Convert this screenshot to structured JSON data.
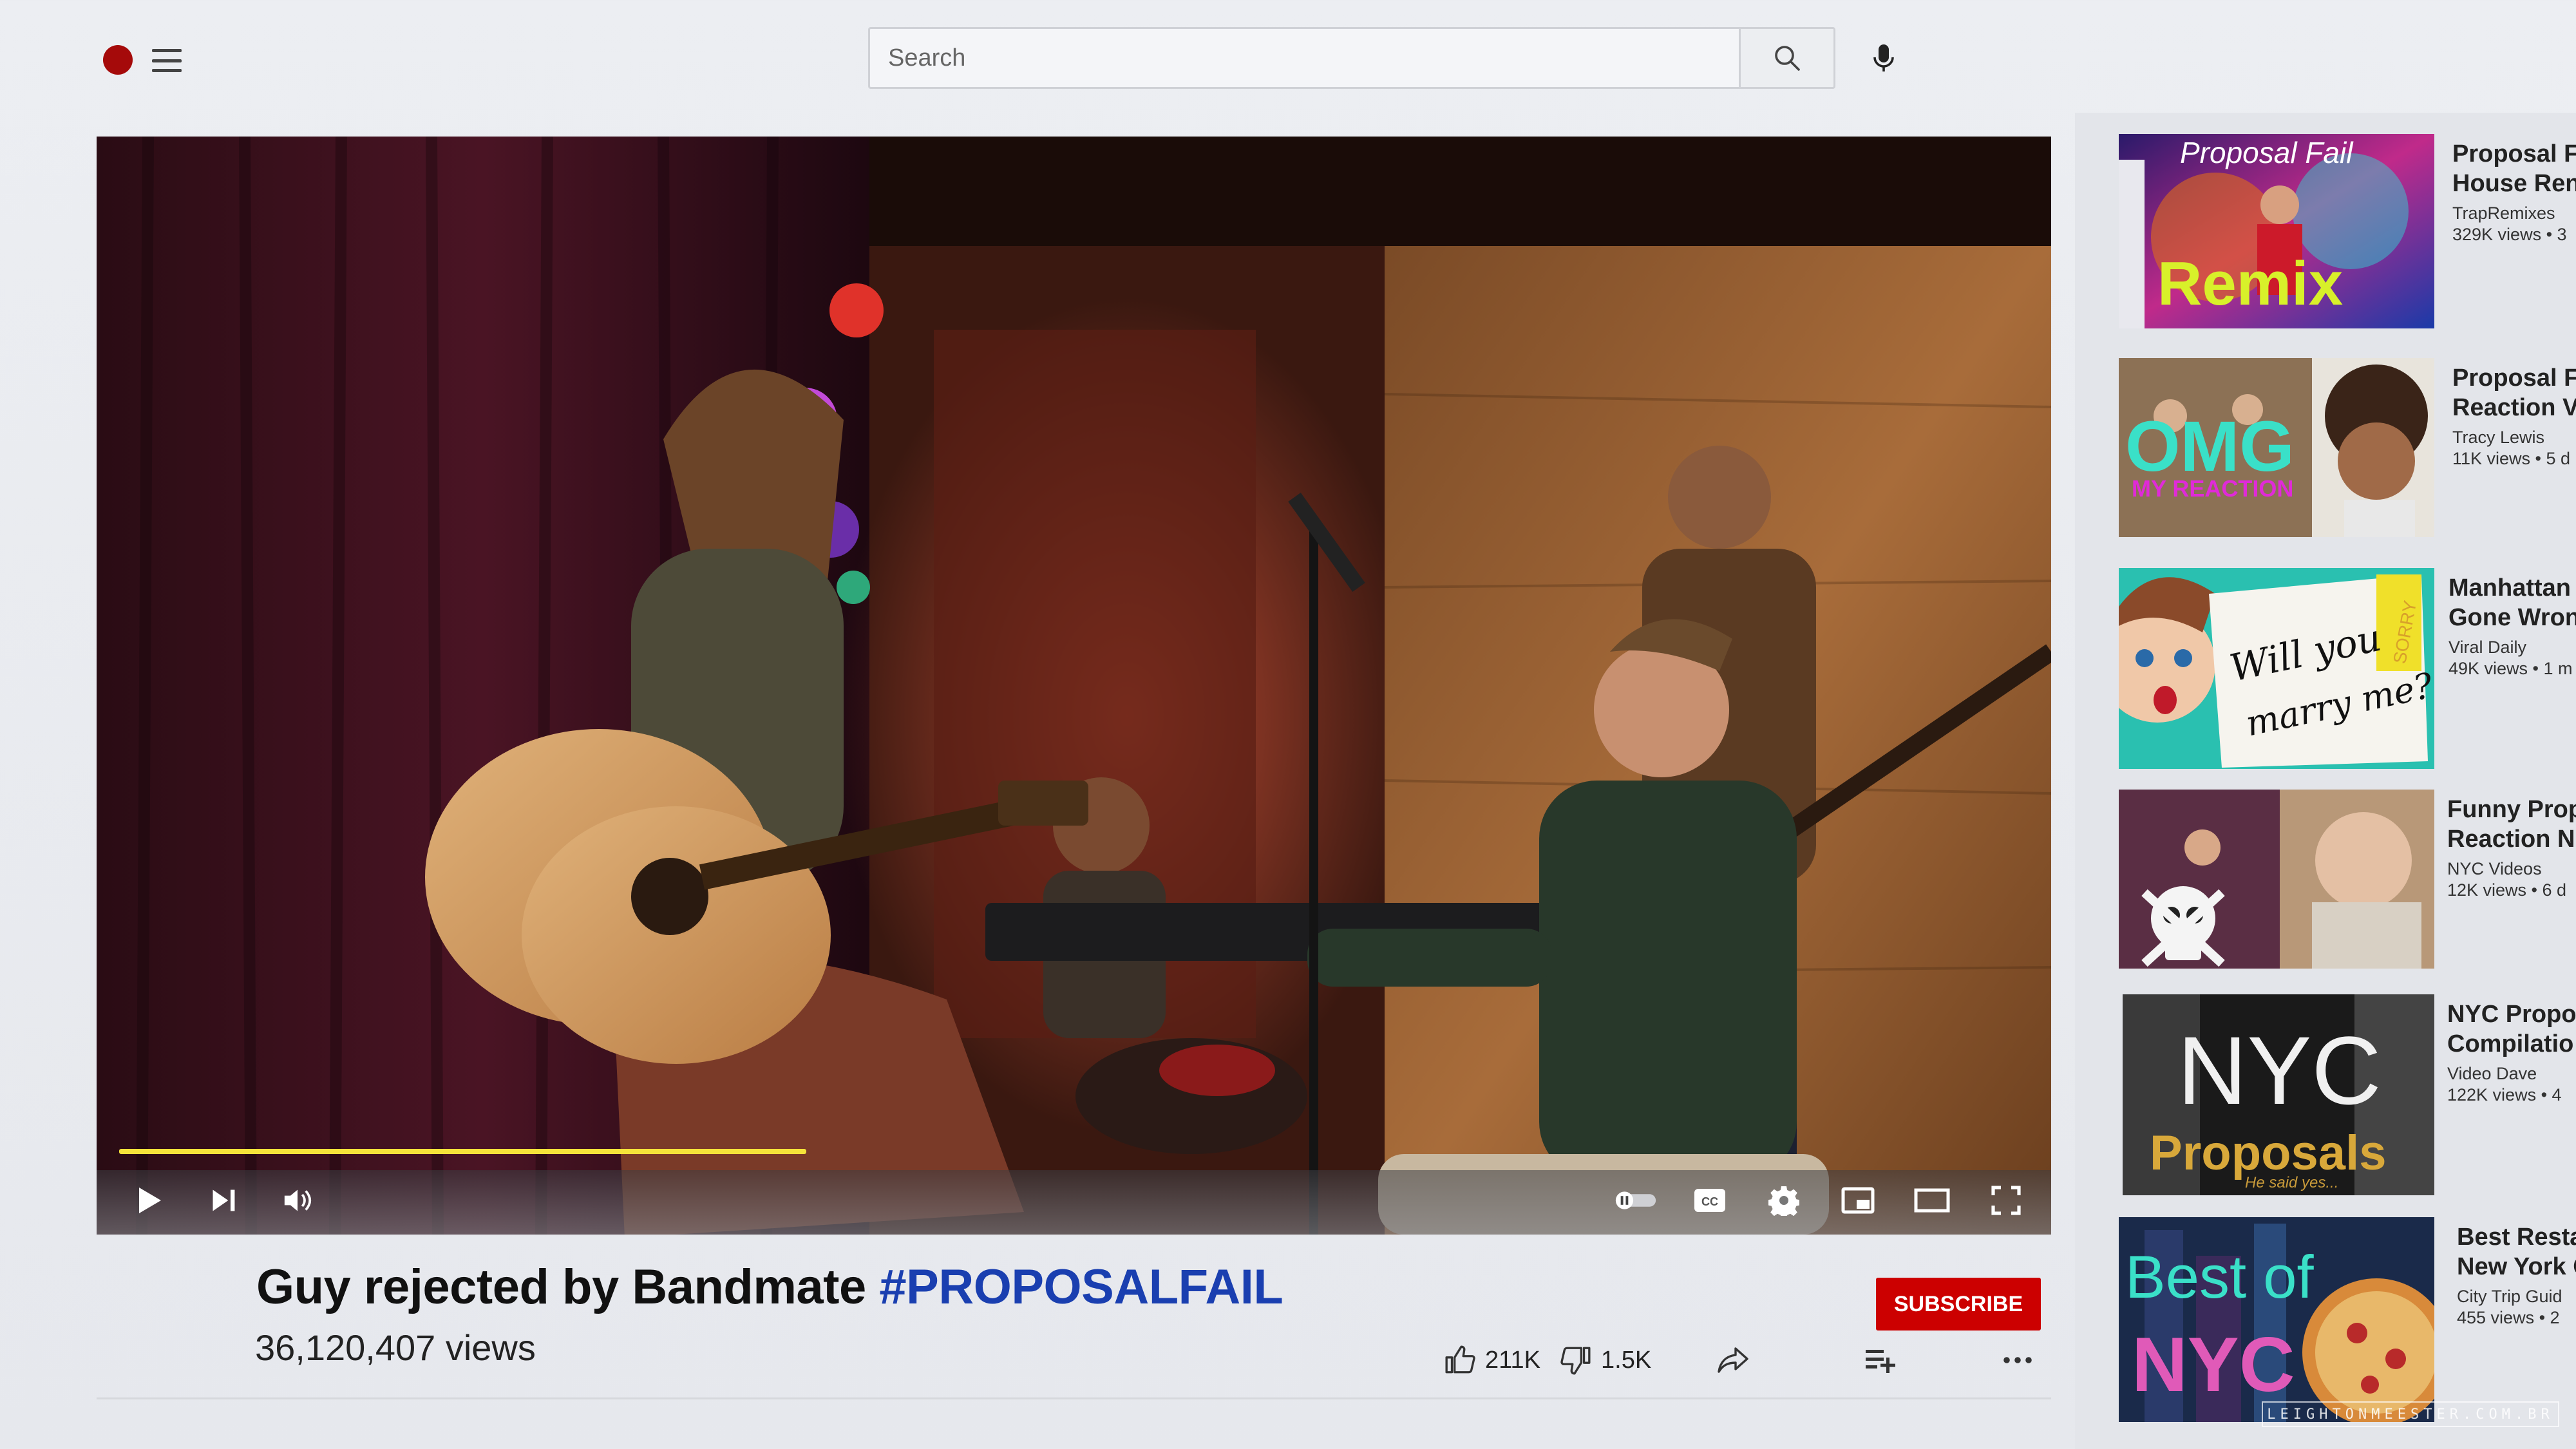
{
  "header": {
    "search_placeholder": "Search"
  },
  "player": {
    "progress_fraction": 0.36,
    "controls": [
      "play",
      "next",
      "volume",
      "autoplay",
      "captions",
      "settings",
      "miniplayer",
      "theater",
      "fullscreen"
    ]
  },
  "video": {
    "title_main": "Guy rejected by Bandmate ",
    "title_hashtag": "#PROPOSALFAIL",
    "views_count": "36,120,407",
    "views_label": " views",
    "likes": "211K",
    "dislikes": "1.5K",
    "subscribe_label": "SUBSCRIBE"
  },
  "sidebar": {
    "items": [
      {
        "title1": "Proposal F",
        "title2": "House Ren",
        "channel": "TrapRemixes",
        "views": "329K views • 3",
        "thumb_text1": "Proposal Fail",
        "thumb_text2": "Remix"
      },
      {
        "title1": "Proposal F",
        "title2": "Reaction V",
        "channel": "Tracy Lewis",
        "views": "11K views • 5 d",
        "thumb_text1": "OMG",
        "thumb_text2": "MY REACTION"
      },
      {
        "title1": "Manhattan",
        "title2": "Gone Wron",
        "channel": "Viral Daily",
        "views": "49K views • 1 m",
        "thumb_text1": "Will you",
        "thumb_text2": "marry me?",
        "thumb_text3": "SORRY"
      },
      {
        "title1": "Funny Prop",
        "title2": "Reaction N",
        "channel": "NYC Videos",
        "views": "12K views • 6 d"
      },
      {
        "title1": "NYC Propo",
        "title2": "Compilatio",
        "channel": "Video Dave",
        "views": "122K views • 4",
        "thumb_text1": "NYC",
        "thumb_text2": "Proposals",
        "thumb_text3": "He said yes..."
      },
      {
        "title1": "Best Resta",
        "title2": "New York C",
        "channel": "City Trip Guid",
        "views": "455 views • 2",
        "thumb_text1": "Best of",
        "thumb_text2": "NYC"
      }
    ]
  },
  "watermark": "LEIGHTONMEESTER.COM.BR",
  "colors": {
    "accent_red": "#cc0000",
    "hashtag_blue": "#1a3fb0",
    "progress_yellow": "#f5e33a"
  }
}
